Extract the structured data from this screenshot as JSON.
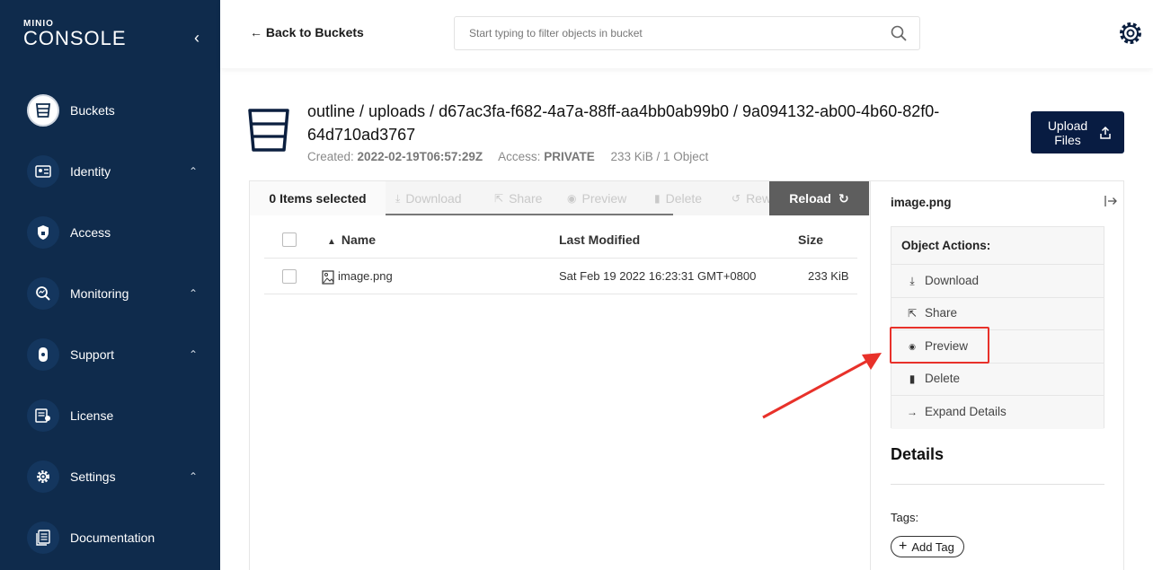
{
  "sidebar": {
    "logo_small": "MINIO",
    "logo_big": "CONSOLE",
    "collapse_icon": "chevron-left-icon",
    "items": [
      {
        "label": "Buckets",
        "icon": "bucket-icon",
        "active": true,
        "expandable": false
      },
      {
        "label": "Identity",
        "icon": "id-card-icon",
        "active": false,
        "expandable": true
      },
      {
        "label": "Access",
        "icon": "lock-shield-icon",
        "active": false,
        "expandable": false
      },
      {
        "label": "Monitoring",
        "icon": "magnifier-chart-icon",
        "active": false,
        "expandable": true
      },
      {
        "label": "Support",
        "icon": "support-icon",
        "active": false,
        "expandable": true
      },
      {
        "label": "License",
        "icon": "license-icon",
        "active": false,
        "expandable": false
      },
      {
        "label": "Settings",
        "icon": "gear-icon",
        "active": false,
        "expandable": true
      },
      {
        "label": "Documentation",
        "icon": "document-icon",
        "active": false,
        "expandable": false
      }
    ]
  },
  "topbar": {
    "back_label": "Back to Buckets",
    "search_placeholder": "Start typing to filter objects in bucket"
  },
  "header": {
    "path": "outline / uploads / d67ac3fa-f682-4a7a-88ff-aa4bb0ab99b0 / 9a094132-ab00-4b60-82f0-64d710ad3767",
    "created_label": "Created:",
    "created_value": "2022-02-19T06:57:29Z",
    "access_label": "Access:",
    "access_value": "PRIVATE",
    "size_info": "233 KiB / 1 Object",
    "upload_label": "Upload Files"
  },
  "toolbar": {
    "selected_count": "0 Items selected",
    "tabs": [
      "Download",
      "Share",
      "Preview",
      "Delete",
      "Rew"
    ],
    "reload_label": "Reload"
  },
  "table": {
    "columns": [
      "Name",
      "Last Modified",
      "Size"
    ],
    "sort_indicator": "▲",
    "rows": [
      {
        "name": "image.png",
        "last_modified": "Sat Feb 19 2022 16:23:31 GMT+0800",
        "size": "233 KiB"
      }
    ]
  },
  "details_panel": {
    "object_name": "image.png",
    "actions_title": "Object Actions:",
    "actions": [
      {
        "label": "Download",
        "icon": "download-icon"
      },
      {
        "label": "Share",
        "icon": "share-icon"
      },
      {
        "label": "Preview",
        "icon": "eye-icon"
      },
      {
        "label": "Delete",
        "icon": "trash-icon"
      },
      {
        "label": "Expand Details",
        "icon": "arrow-right-icon"
      }
    ],
    "details_title": "Details",
    "tags_label": "Tags:",
    "add_tag_label": "Add Tag"
  },
  "colors": {
    "sidebar_bg": "#0f2b4c",
    "primary_button": "#081c42",
    "reload_button": "#5e5e5e",
    "annotation": "#e8312a"
  }
}
